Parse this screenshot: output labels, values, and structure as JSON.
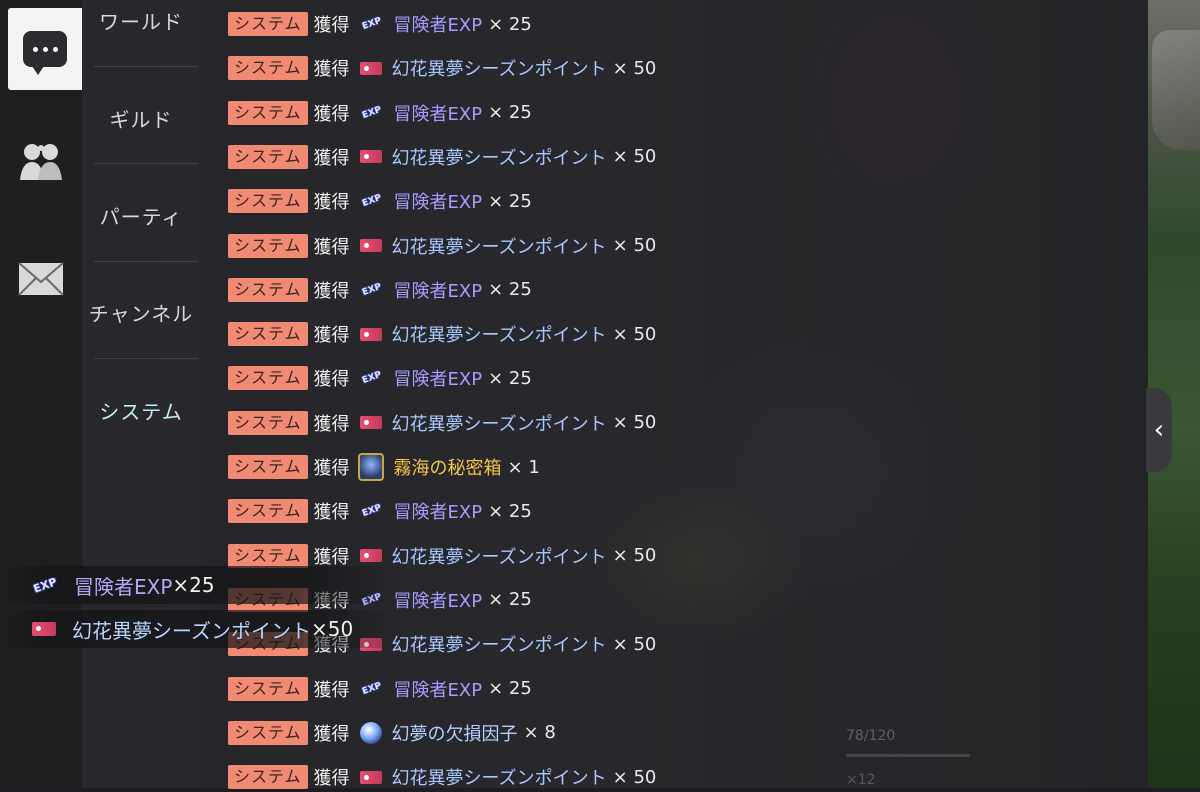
{
  "sidebar": {
    "icons": [
      {
        "name": "chat-icon",
        "active": true
      },
      {
        "name": "friends-icon",
        "active": false
      },
      {
        "name": "mail-icon",
        "active": false
      }
    ]
  },
  "categories": [
    "ワールド",
    "ギルド",
    "パーティ",
    "チャンネル",
    "システム"
  ],
  "selected_category": "システム",
  "log_rows": [
    {
      "tag": "システム",
      "verb": "獲得",
      "icon": "exp-icon",
      "item": "冒険者EXP",
      "qty": "× 25",
      "kind": "exp"
    },
    {
      "tag": "システム",
      "verb": "獲得",
      "icon": "ticket-icon",
      "item": "幻花異夢シーズンポイント",
      "qty": "× 50",
      "kind": "pt"
    },
    {
      "tag": "システム",
      "verb": "獲得",
      "icon": "exp-icon",
      "item": "冒険者EXP",
      "qty": "× 25",
      "kind": "exp"
    },
    {
      "tag": "システム",
      "verb": "獲得",
      "icon": "ticket-icon",
      "item": "幻花異夢シーズンポイント",
      "qty": "× 50",
      "kind": "pt"
    },
    {
      "tag": "システム",
      "verb": "獲得",
      "icon": "exp-icon",
      "item": "冒険者EXP",
      "qty": "× 25",
      "kind": "exp"
    },
    {
      "tag": "システム",
      "verb": "獲得",
      "icon": "ticket-icon",
      "item": "幻花異夢シーズンポイント",
      "qty": "× 50",
      "kind": "pt"
    },
    {
      "tag": "システム",
      "verb": "獲得",
      "icon": "exp-icon",
      "item": "冒険者EXP",
      "qty": "× 25",
      "kind": "exp"
    },
    {
      "tag": "システム",
      "verb": "獲得",
      "icon": "ticket-icon",
      "item": "幻花異夢シーズンポイント",
      "qty": "× 50",
      "kind": "pt"
    },
    {
      "tag": "システム",
      "verb": "獲得",
      "icon": "exp-icon",
      "item": "冒険者EXP",
      "qty": "× 25",
      "kind": "exp"
    },
    {
      "tag": "システム",
      "verb": "獲得",
      "icon": "ticket-icon",
      "item": "幻花異夢シーズンポイント",
      "qty": "× 50",
      "kind": "pt"
    },
    {
      "tag": "システム",
      "verb": "獲得",
      "icon": "chest-icon",
      "item": "霧海の秘密箱",
      "qty": "× 1",
      "kind": "gold"
    },
    {
      "tag": "システム",
      "verb": "獲得",
      "icon": "exp-icon",
      "item": "冒険者EXP",
      "qty": "× 25",
      "kind": "exp"
    },
    {
      "tag": "システム",
      "verb": "獲得",
      "icon": "ticket-icon",
      "item": "幻花異夢シーズンポイント",
      "qty": "× 50",
      "kind": "pt"
    },
    {
      "tag": "システム",
      "verb": "獲得",
      "icon": "exp-icon",
      "item": "冒険者EXP",
      "qty": "× 25",
      "kind": "exp"
    },
    {
      "tag": "システム",
      "verb": "獲得",
      "icon": "ticket-icon",
      "item": "幻花異夢シーズンポイント",
      "qty": "× 50",
      "kind": "pt"
    },
    {
      "tag": "システム",
      "verb": "獲得",
      "icon": "exp-icon",
      "item": "冒険者EXP",
      "qty": "× 25",
      "kind": "exp"
    },
    {
      "tag": "システム",
      "verb": "獲得",
      "icon": "orb-icon",
      "item": "幻夢の欠損因子",
      "qty": "× 8",
      "kind": "blue"
    },
    {
      "tag": "システム",
      "verb": "獲得",
      "icon": "ticket-icon",
      "item": "幻花異夢シーズンポイント",
      "qty": "× 50",
      "kind": "pt"
    }
  ],
  "toasts": [
    {
      "icon": "exp-icon",
      "item": "冒険者EXP",
      "mult": "×25"
    },
    {
      "icon": "ticket-icon",
      "item": "幻花異夢シーズンポイント",
      "mult": "×50"
    }
  ],
  "collapse_handle": "‹",
  "hud": {
    "count": "78/120",
    "small": "×12"
  },
  "colors": {
    "tag_bg": "#f08a72",
    "exp_text": "#a79cff",
    "points_text": "#a9c8ff",
    "chest_text": "#f2c64a",
    "selected_category": "#bfeef2"
  }
}
